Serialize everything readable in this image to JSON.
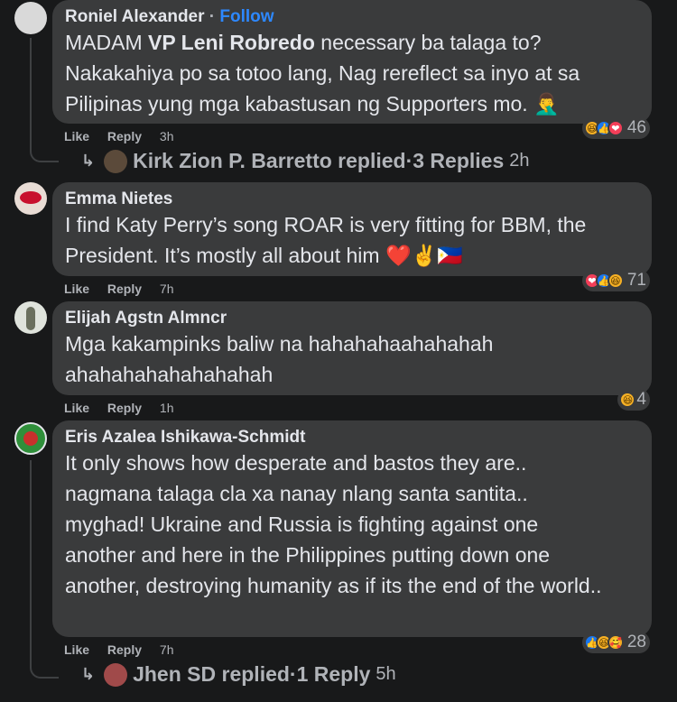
{
  "comments": [
    {
      "author": "Roniel Alexander",
      "follow": "Follow",
      "text_pre": "MADAM ",
      "text_bold": "VP Leni Robredo",
      "text_post": " necessary ba talaga to? Nakakahiya po sa totoo lang, Nag rereflect sa inyo at sa Pilipinas yung mga kabastusan ng Supporters mo. 🤦‍♂️",
      "like": "Like",
      "reply": "Reply",
      "time": "3h",
      "reactions": [
        "haha",
        "like",
        "love"
      ],
      "count": "46",
      "replies": {
        "author": "Kirk Zion P. Barretto replied",
        "sep": " · ",
        "count": "3 Replies",
        "time": "2h"
      }
    },
    {
      "author": "Emma Nietes",
      "text": "I find Katy Perry’s song ROAR is very fitting for BBM, the President. It’s mostly all about him ❤️✌️🇵🇭",
      "like": "Like",
      "reply": "Reply",
      "time": "7h",
      "reactions": [
        "love",
        "like",
        "haha"
      ],
      "count": "71"
    },
    {
      "author": "Elijah Agstn Almncr",
      "text": "Mga kakampinks baliw na hahahahaahahahahahahahahahahahahah",
      "like": "Like",
      "reply": "Reply",
      "time": "1h",
      "reactions": [
        "haha"
      ],
      "count": "4"
    },
    {
      "author": "Eris Azalea Ishikawa-Schmidt",
      "text": "It only shows how desperate and bastos they are.. nagmana talaga cla xa nanay nlang santa santita.. myghad! Ukraine and Russia is fighting against one another and here in the Philippines putting down one another, destroying humanity as if its the end of the world..",
      "like": "Like",
      "reply": "Reply",
      "time": "7h",
      "reactions": [
        "like",
        "haha",
        "care"
      ],
      "count": "28",
      "replies": {
        "author": "Jhen SD replied",
        "sep": " · ",
        "count": "1 Reply",
        "time": "5h"
      }
    }
  ],
  "icons": {
    "haha": "😆",
    "like": "👍",
    "love": "❤",
    "care": "🥰",
    "reply_arrow": "↳"
  }
}
